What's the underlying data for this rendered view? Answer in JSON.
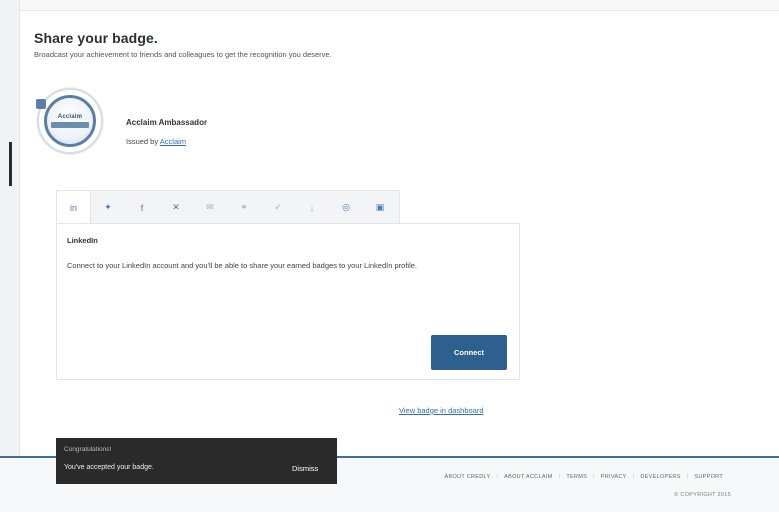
{
  "header": {
    "title": "Share your badge.",
    "subtitle": "Broadcast your achievement to friends and colleagues to get the recognition you deserve."
  },
  "badge": {
    "image_text": "Acclaim",
    "name": "Acclaim Ambassador",
    "issued_by_prefix": "Issued by",
    "issuer": "Acclaim"
  },
  "share_tabs": [
    {
      "icon": "linkedin-icon",
      "glyph": "in"
    },
    {
      "icon": "twitter-icon",
      "glyph": "✦"
    },
    {
      "icon": "facebook-icon",
      "glyph": "f"
    },
    {
      "icon": "xing-icon",
      "glyph": "✕"
    },
    {
      "icon": "email-icon",
      "glyph": "✉"
    },
    {
      "icon": "link-icon",
      "glyph": "⚭"
    },
    {
      "icon": "verify-icon",
      "glyph": "✓"
    },
    {
      "icon": "download-icon",
      "glyph": "↓"
    },
    {
      "icon": "embed-icon",
      "glyph": "◎"
    },
    {
      "icon": "print-icon",
      "glyph": "▣"
    }
  ],
  "panel": {
    "heading": "LinkedIn",
    "text": "Connect to your LinkedIn account and you'll be able to share your earned badges to your LinkedIn profile.",
    "connect_label": "Connect"
  },
  "view_dashboard_label": "View badge in dashboard",
  "toast": {
    "title": "Congratulations!",
    "message": "You've accepted your badge.",
    "dismiss_label": "Dismiss"
  },
  "footer": {
    "links": [
      "ABOUT CREDLY",
      "ABOUT ACCLAIM",
      "TERMS",
      "PRIVACY",
      "DEVELOPERS",
      "SUPPORT"
    ],
    "copyright": "© COPYRIGHT 2015"
  },
  "colors": {
    "primary_button": "#2d5f8f",
    "link": "#2f6fa7",
    "footer_rule": "#3f6f98",
    "toast_bg": "#2a2a2a"
  }
}
